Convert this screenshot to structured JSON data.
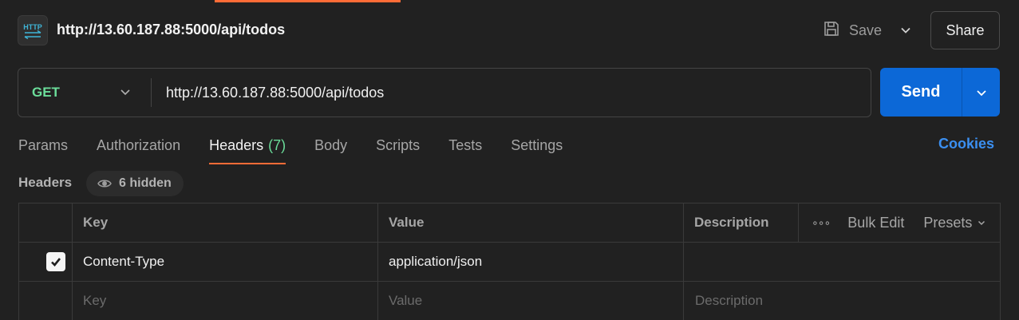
{
  "request": {
    "title": "http://13.60.187.88:5000/api/todos",
    "method": "GET",
    "url": "http://13.60.187.88:5000/api/todos"
  },
  "toolbar": {
    "save_label": "Save",
    "share_label": "Share",
    "send_label": "Send"
  },
  "tabs": [
    {
      "label": "Params"
    },
    {
      "label": "Authorization"
    },
    {
      "label": "Headers",
      "count": "(7)",
      "active": true
    },
    {
      "label": "Body"
    },
    {
      "label": "Scripts"
    },
    {
      "label": "Tests"
    },
    {
      "label": "Settings"
    }
  ],
  "cookies_label": "Cookies",
  "headers_section": {
    "label": "Headers",
    "hidden_label": "6 hidden"
  },
  "table": {
    "columns": {
      "key": "Key",
      "value": "Value",
      "description": "Description"
    },
    "actions": {
      "more": "∘∘∘",
      "bulk_edit": "Bulk Edit",
      "presets": "Presets"
    },
    "rows": [
      {
        "checked": true,
        "key": "Content-Type",
        "value": "application/json",
        "description": ""
      }
    ],
    "placeholder": {
      "key": "Key",
      "value": "Value",
      "description": "Description"
    }
  },
  "colors": {
    "accent_orange": "#ff6c37",
    "method_green": "#6bdd9a",
    "send_blue": "#0c68d7",
    "link_blue": "#3b8ff0"
  }
}
